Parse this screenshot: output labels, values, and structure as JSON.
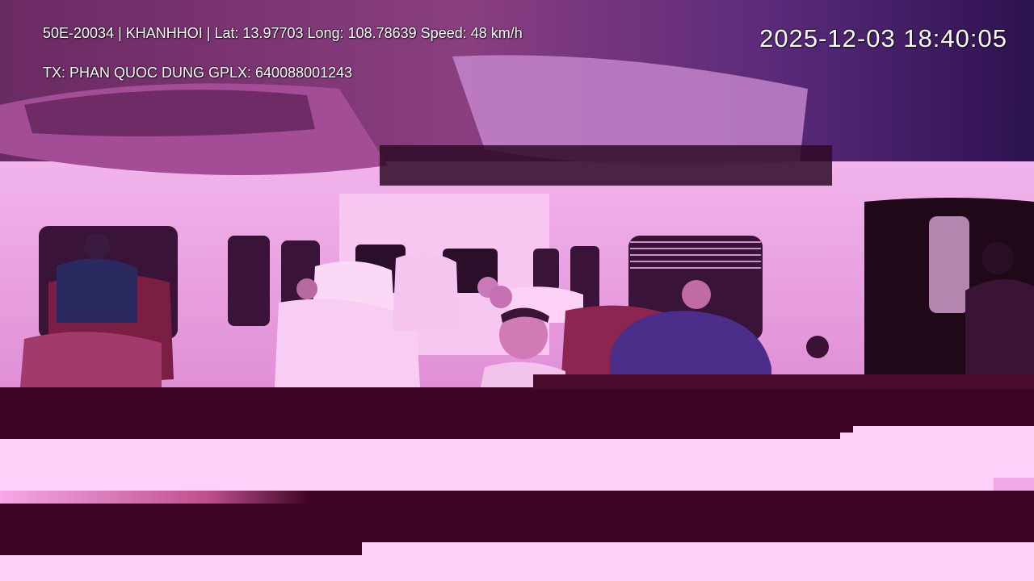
{
  "overlay": {
    "vehicle_line": "50E-20034 | KHANHHOI | Lat: 13.97703 Long: 108.78639 Speed: 48 km/h",
    "driver_line": "TX: PHAN QUOC DUNG GPLX: 640088001243",
    "timestamp": "2025-12-03 18:40:05"
  },
  "scene": {
    "subject": "dashcam-view-of-van-interior-with-passengers",
    "colors": {
      "cabin_tint": "#e89ae0",
      "ceiling_dark": "#5a1f4f",
      "corrupt_dark": "#3d0424",
      "corrupt_light": "#fcd0f8"
    }
  }
}
